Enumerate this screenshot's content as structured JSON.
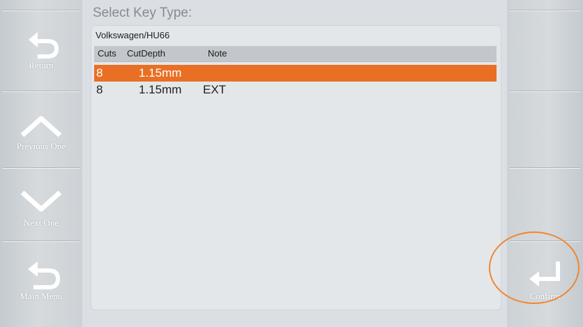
{
  "screen": {
    "title": "Select Key Type:",
    "model": "Volkswagen/HU66"
  },
  "left_buttons": [
    {
      "label": "Return",
      "icon": "return-icon"
    },
    {
      "label": "Previous One",
      "icon": "chevron-up-icon"
    },
    {
      "label": "Next One",
      "icon": "chevron-down-icon"
    },
    {
      "label": "Main Menu",
      "icon": "main-menu-icon"
    }
  ],
  "right_buttons": [
    {
      "label": "Confirm",
      "icon": "enter-icon"
    }
  ],
  "table": {
    "columns": [
      "Cuts",
      "CutDepth",
      "Note"
    ],
    "rows": [
      {
        "cuts": "8",
        "depth": "1.15mm",
        "note": "",
        "selected": true
      },
      {
        "cuts": "8",
        "depth": "1.15mm",
        "note": "EXT",
        "selected": false
      }
    ]
  },
  "colors": {
    "selection": "#e96f24",
    "highlight_circle": "#f0862f",
    "sidebar": "#cdd2d6",
    "panel": "#e4e7ea"
  }
}
